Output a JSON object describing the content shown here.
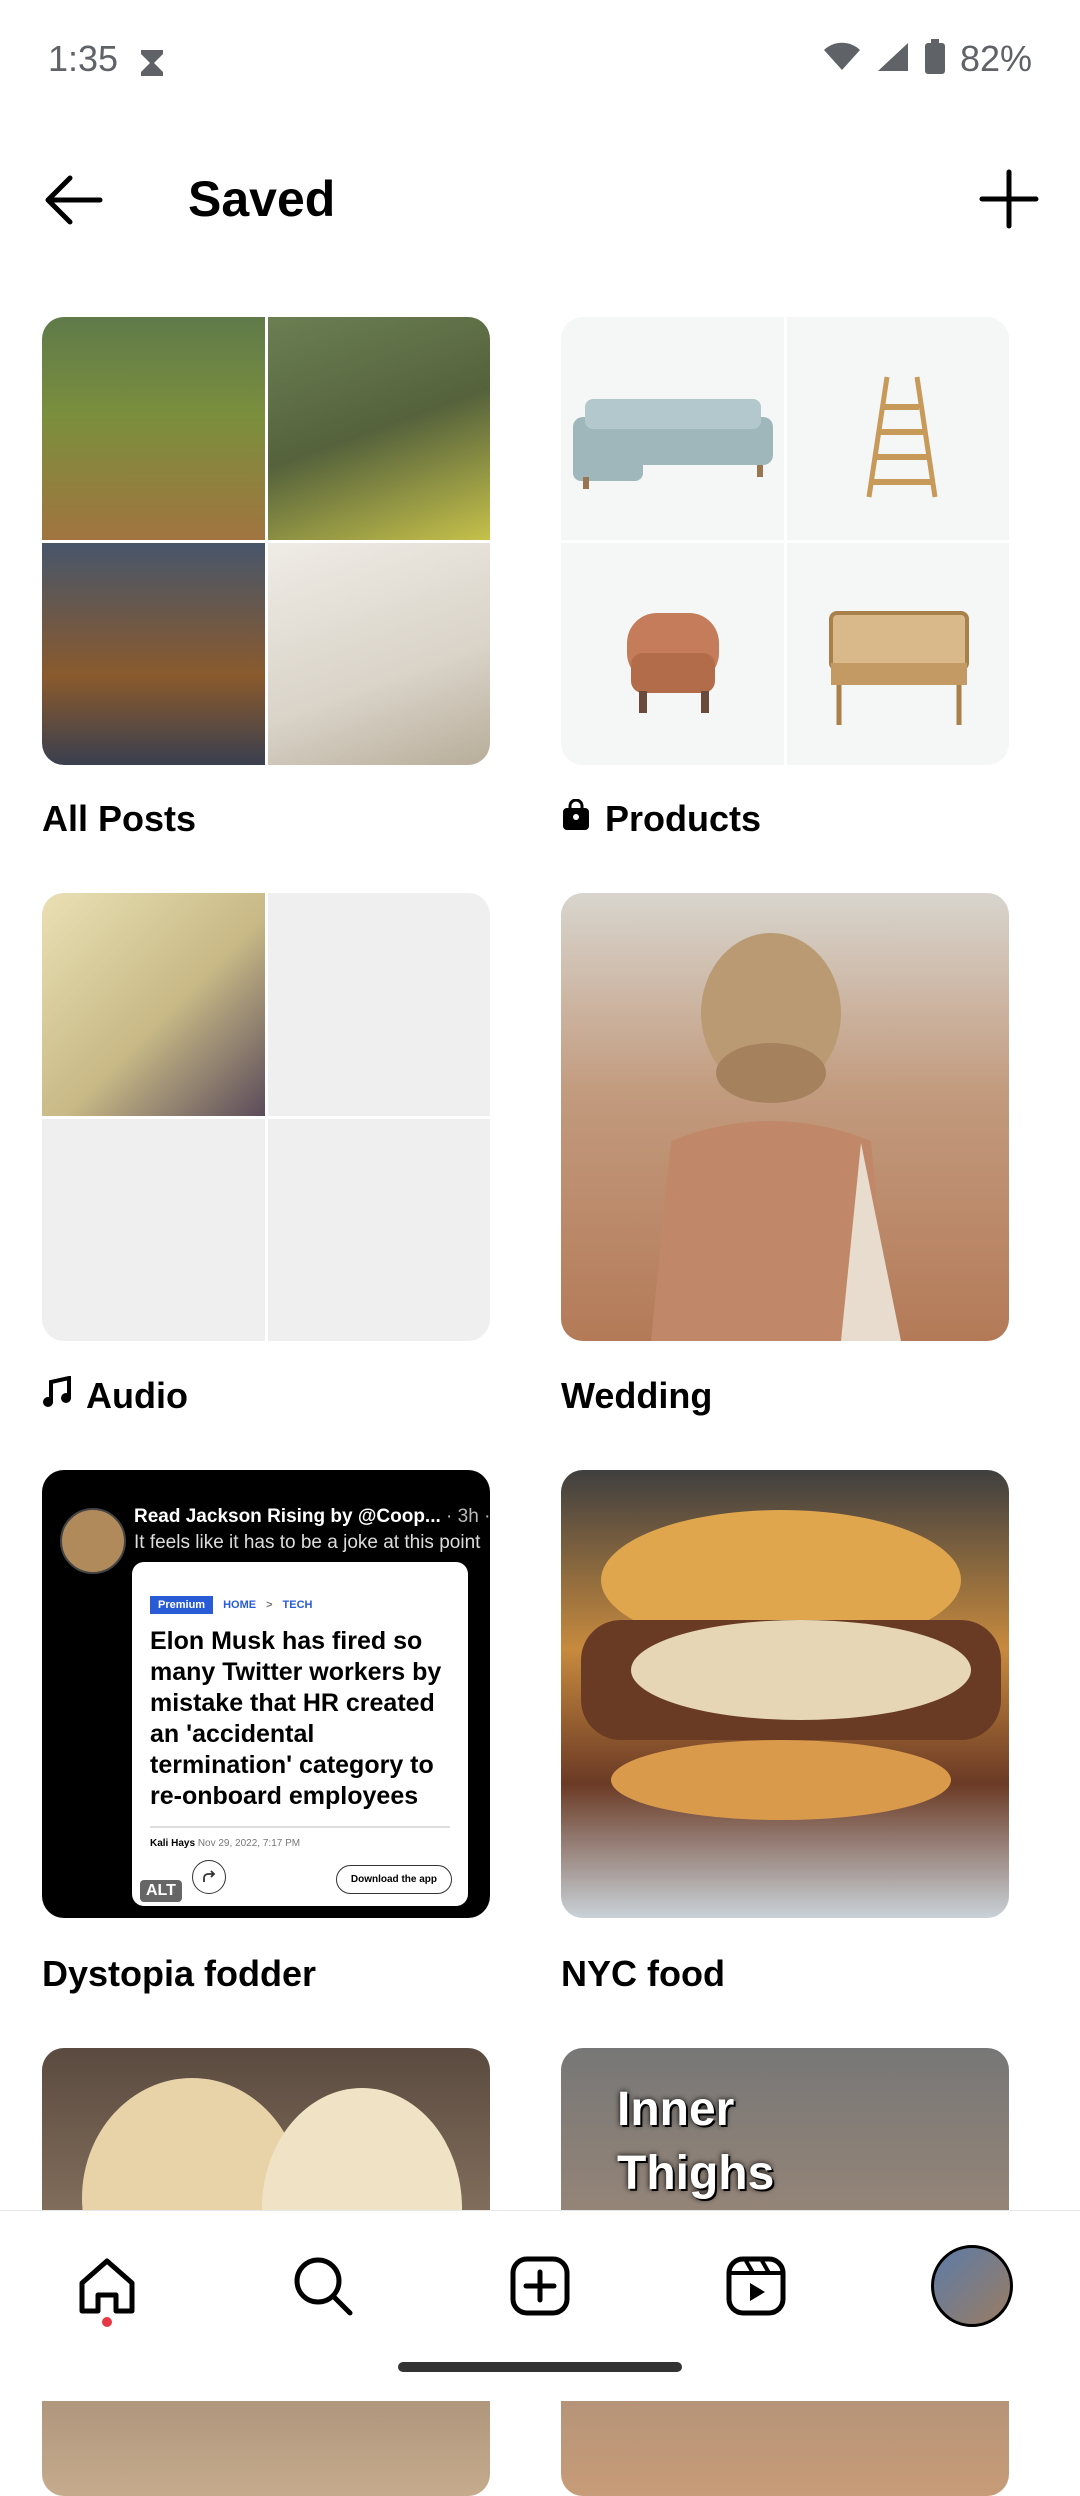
{
  "status_bar": {
    "time": "1:35",
    "battery": "82%"
  },
  "header": {
    "title": "Saved"
  },
  "collections": [
    {
      "label": "All Posts"
    },
    {
      "label": "Products"
    },
    {
      "label": "Audio"
    },
    {
      "label": "Wedding"
    },
    {
      "label": "Dystopia fodder"
    },
    {
      "label": "NYC food"
    }
  ],
  "dystopia_post": {
    "author_line": "Read Jackson Rising by @Coop...",
    "time": "· 3h",
    "more": "···",
    "subtitle": "It feels like it has to be a joke at this point",
    "premium": "Premium",
    "crumb_home": "HOME",
    "crumb_sep": ">",
    "crumb_tech": "TECH",
    "headline": "Elon Musk has fired so many Twitter workers by mistake that HR created an 'accidental termination' category to re-onboard employees",
    "byline": "Kali Hays",
    "date": "Nov 29, 2022, 7:17 PM",
    "download": "Download the app",
    "alt": "ALT"
  },
  "gym_overlay": {
    "line1": "Inner",
    "line2": "Thighs"
  },
  "colors": {
    "notification_dot": "#e63946"
  }
}
